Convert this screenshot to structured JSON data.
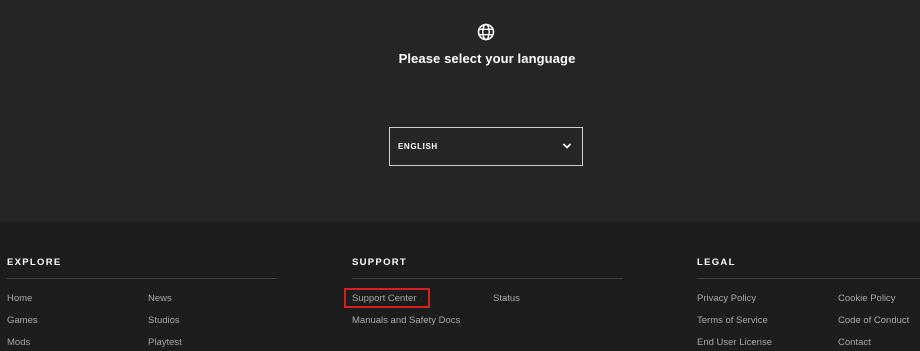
{
  "language": {
    "title": "Please select your language",
    "selected": "ENGLISH"
  },
  "footer": {
    "explore": {
      "title": "EXPLORE",
      "links": [
        "Home",
        "News",
        "Games",
        "Studios",
        "Mods",
        "Playtest"
      ]
    },
    "support": {
      "title": "SUPPORT",
      "links": [
        "Support Center",
        "Status",
        "Manuals and Safety Docs"
      ]
    },
    "legal": {
      "title": "LEGAL",
      "links": [
        "Privacy Policy",
        "Cookie Policy",
        "Terms of Service",
        "Code of Conduct",
        "End User License",
        "Contact"
      ]
    }
  },
  "colors": {
    "top_bg": "#262626",
    "footer_bg": "#1d1d1d",
    "link": "#a6a6a6",
    "highlight": "#d61f1f"
  }
}
